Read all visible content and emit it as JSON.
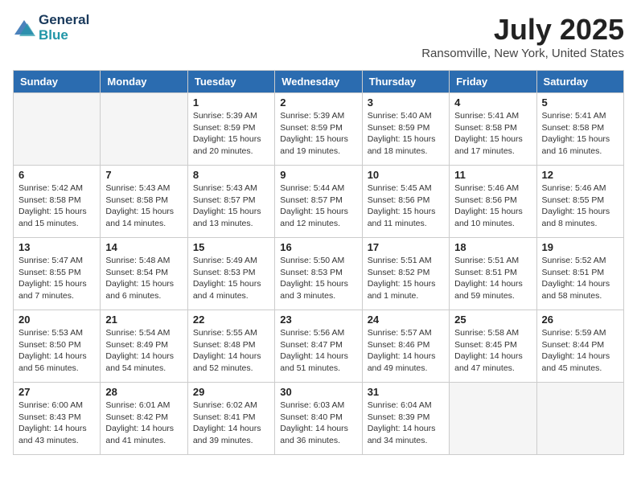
{
  "header": {
    "logo_line1": "General",
    "logo_line2": "Blue",
    "month_title": "July 2025",
    "location": "Ransomville, New York, United States"
  },
  "weekdays": [
    "Sunday",
    "Monday",
    "Tuesday",
    "Wednesday",
    "Thursday",
    "Friday",
    "Saturday"
  ],
  "weeks": [
    [
      {
        "day": "",
        "info": ""
      },
      {
        "day": "",
        "info": ""
      },
      {
        "day": "1",
        "info": "Sunrise: 5:39 AM\nSunset: 8:59 PM\nDaylight: 15 hours and 20 minutes."
      },
      {
        "day": "2",
        "info": "Sunrise: 5:39 AM\nSunset: 8:59 PM\nDaylight: 15 hours and 19 minutes."
      },
      {
        "day": "3",
        "info": "Sunrise: 5:40 AM\nSunset: 8:59 PM\nDaylight: 15 hours and 18 minutes."
      },
      {
        "day": "4",
        "info": "Sunrise: 5:41 AM\nSunset: 8:58 PM\nDaylight: 15 hours and 17 minutes."
      },
      {
        "day": "5",
        "info": "Sunrise: 5:41 AM\nSunset: 8:58 PM\nDaylight: 15 hours and 16 minutes."
      }
    ],
    [
      {
        "day": "6",
        "info": "Sunrise: 5:42 AM\nSunset: 8:58 PM\nDaylight: 15 hours and 15 minutes."
      },
      {
        "day": "7",
        "info": "Sunrise: 5:43 AM\nSunset: 8:58 PM\nDaylight: 15 hours and 14 minutes."
      },
      {
        "day": "8",
        "info": "Sunrise: 5:43 AM\nSunset: 8:57 PM\nDaylight: 15 hours and 13 minutes."
      },
      {
        "day": "9",
        "info": "Sunrise: 5:44 AM\nSunset: 8:57 PM\nDaylight: 15 hours and 12 minutes."
      },
      {
        "day": "10",
        "info": "Sunrise: 5:45 AM\nSunset: 8:56 PM\nDaylight: 15 hours and 11 minutes."
      },
      {
        "day": "11",
        "info": "Sunrise: 5:46 AM\nSunset: 8:56 PM\nDaylight: 15 hours and 10 minutes."
      },
      {
        "day": "12",
        "info": "Sunrise: 5:46 AM\nSunset: 8:55 PM\nDaylight: 15 hours and 8 minutes."
      }
    ],
    [
      {
        "day": "13",
        "info": "Sunrise: 5:47 AM\nSunset: 8:55 PM\nDaylight: 15 hours and 7 minutes."
      },
      {
        "day": "14",
        "info": "Sunrise: 5:48 AM\nSunset: 8:54 PM\nDaylight: 15 hours and 6 minutes."
      },
      {
        "day": "15",
        "info": "Sunrise: 5:49 AM\nSunset: 8:53 PM\nDaylight: 15 hours and 4 minutes."
      },
      {
        "day": "16",
        "info": "Sunrise: 5:50 AM\nSunset: 8:53 PM\nDaylight: 15 hours and 3 minutes."
      },
      {
        "day": "17",
        "info": "Sunrise: 5:51 AM\nSunset: 8:52 PM\nDaylight: 15 hours and 1 minute."
      },
      {
        "day": "18",
        "info": "Sunrise: 5:51 AM\nSunset: 8:51 PM\nDaylight: 14 hours and 59 minutes."
      },
      {
        "day": "19",
        "info": "Sunrise: 5:52 AM\nSunset: 8:51 PM\nDaylight: 14 hours and 58 minutes."
      }
    ],
    [
      {
        "day": "20",
        "info": "Sunrise: 5:53 AM\nSunset: 8:50 PM\nDaylight: 14 hours and 56 minutes."
      },
      {
        "day": "21",
        "info": "Sunrise: 5:54 AM\nSunset: 8:49 PM\nDaylight: 14 hours and 54 minutes."
      },
      {
        "day": "22",
        "info": "Sunrise: 5:55 AM\nSunset: 8:48 PM\nDaylight: 14 hours and 52 minutes."
      },
      {
        "day": "23",
        "info": "Sunrise: 5:56 AM\nSunset: 8:47 PM\nDaylight: 14 hours and 51 minutes."
      },
      {
        "day": "24",
        "info": "Sunrise: 5:57 AM\nSunset: 8:46 PM\nDaylight: 14 hours and 49 minutes."
      },
      {
        "day": "25",
        "info": "Sunrise: 5:58 AM\nSunset: 8:45 PM\nDaylight: 14 hours and 47 minutes."
      },
      {
        "day": "26",
        "info": "Sunrise: 5:59 AM\nSunset: 8:44 PM\nDaylight: 14 hours and 45 minutes."
      }
    ],
    [
      {
        "day": "27",
        "info": "Sunrise: 6:00 AM\nSunset: 8:43 PM\nDaylight: 14 hours and 43 minutes."
      },
      {
        "day": "28",
        "info": "Sunrise: 6:01 AM\nSunset: 8:42 PM\nDaylight: 14 hours and 41 minutes."
      },
      {
        "day": "29",
        "info": "Sunrise: 6:02 AM\nSunset: 8:41 PM\nDaylight: 14 hours and 39 minutes."
      },
      {
        "day": "30",
        "info": "Sunrise: 6:03 AM\nSunset: 8:40 PM\nDaylight: 14 hours and 36 minutes."
      },
      {
        "day": "31",
        "info": "Sunrise: 6:04 AM\nSunset: 8:39 PM\nDaylight: 14 hours and 34 minutes."
      },
      {
        "day": "",
        "info": ""
      },
      {
        "day": "",
        "info": ""
      }
    ]
  ]
}
